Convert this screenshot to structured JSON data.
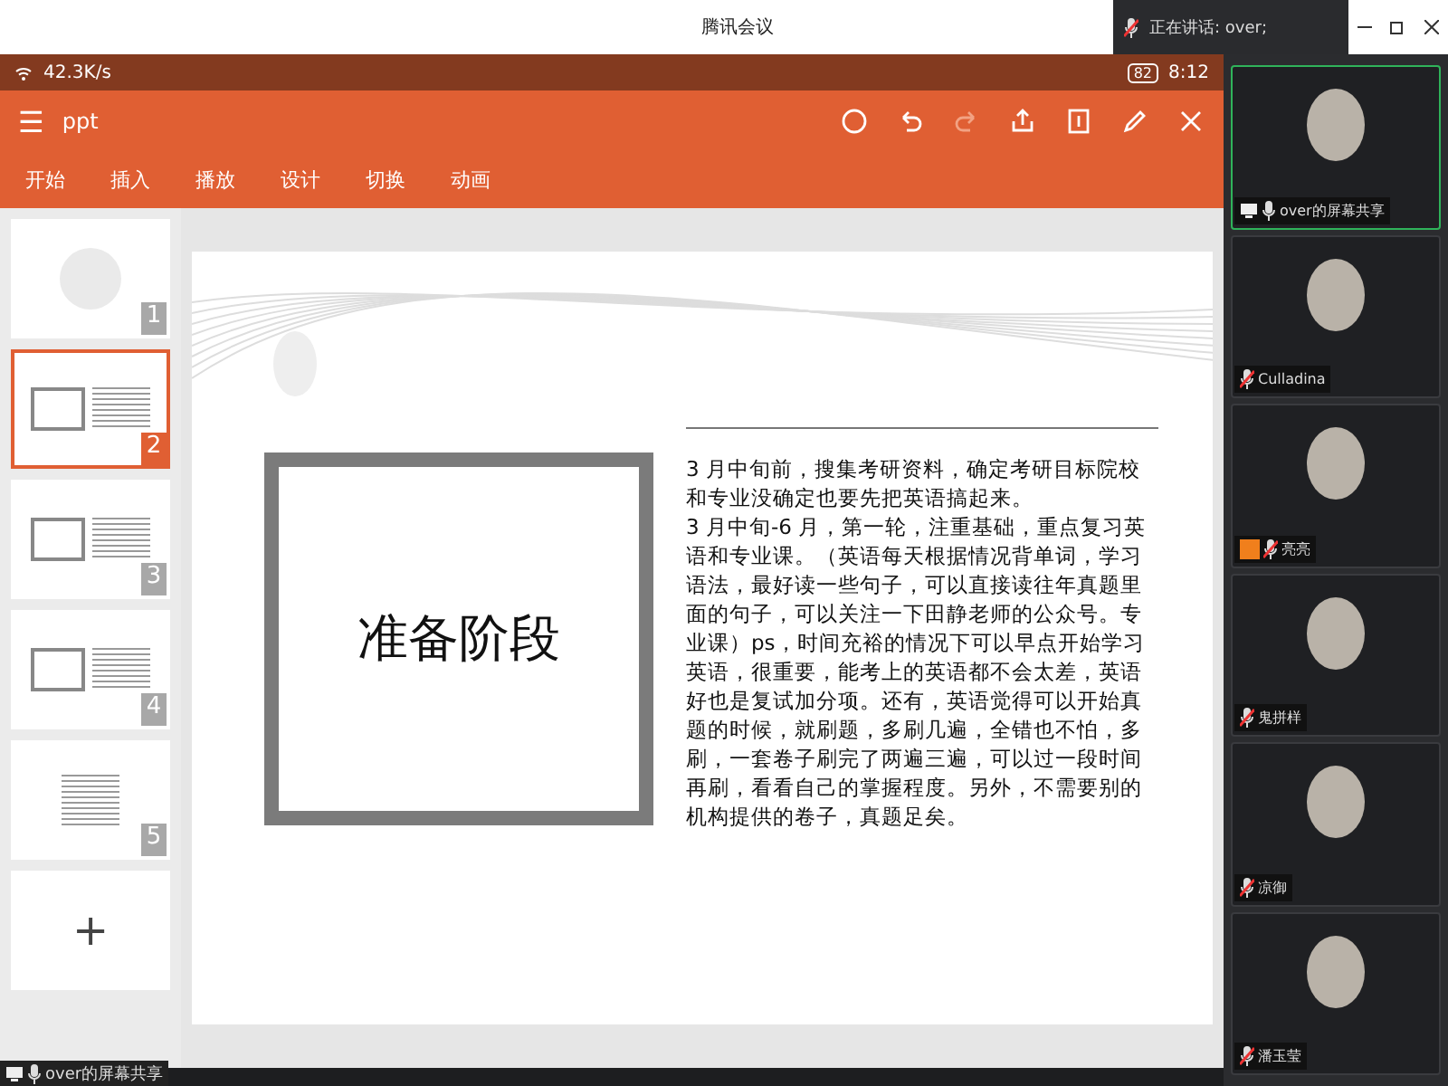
{
  "window": {
    "title": "腾讯会议",
    "speaking": "正在讲话: over;"
  },
  "status_bar": {
    "speed": "42.3K/s",
    "battery": "82",
    "time": "8:12"
  },
  "toolbar": {
    "menu": "☰",
    "title": "ppt"
  },
  "tabs": [
    "开始",
    "插入",
    "播放",
    "设计",
    "切换",
    "动画"
  ],
  "thumbnails": [
    {
      "number": "1",
      "selected": false,
      "kind": "title"
    },
    {
      "number": "2",
      "selected": true,
      "kind": "box-text"
    },
    {
      "number": "3",
      "selected": false,
      "kind": "box-text"
    },
    {
      "number": "4",
      "selected": false,
      "kind": "box-text"
    },
    {
      "number": "5",
      "selected": false,
      "kind": "text"
    }
  ],
  "add_slide": "+",
  "slide": {
    "heading": "准备阶段",
    "body": "3 月中旬前，搜集考研资料，确定考研目标院校和专业没确定也要先把英语搞起来。\n3 月中旬-6 月，第一轮，注重基础，重点复习英语和专业课。（英语每天根据情况背单词，学习语法，最好读一些句子，可以直接读往年真题里面的句子，可以关注一下田静老师的公众号。专业课）ps，时间充裕的情况下可以早点开始学习英语，很重要，能考上的英语都不会太差，英语好也是复试加分项。还有，英语觉得可以开始真题的时候，就刷题，多刷几遍，全错也不怕，多刷，一套卷子刷完了两遍三遍，可以过一段时间再刷，看看自己的掌握程度。另外，不需要别的机构提供的卷子，真题足矣。"
  },
  "share_label": "over的屏幕共享",
  "participants": [
    {
      "name": "over的屏幕共享",
      "muted": false,
      "host": false,
      "sharing": true,
      "selected": true
    },
    {
      "name": "Culladina",
      "muted": true,
      "host": false,
      "sharing": false,
      "selected": false
    },
    {
      "name": "亮亮",
      "muted": true,
      "host": true,
      "sharing": false,
      "selected": false
    },
    {
      "name": "鬼拼样",
      "muted": true,
      "host": false,
      "sharing": false,
      "selected": false
    },
    {
      "name": "凉御",
      "muted": true,
      "host": false,
      "sharing": false,
      "selected": false
    },
    {
      "name": "潘玉莹",
      "muted": true,
      "host": false,
      "sharing": false,
      "selected": false
    }
  ]
}
